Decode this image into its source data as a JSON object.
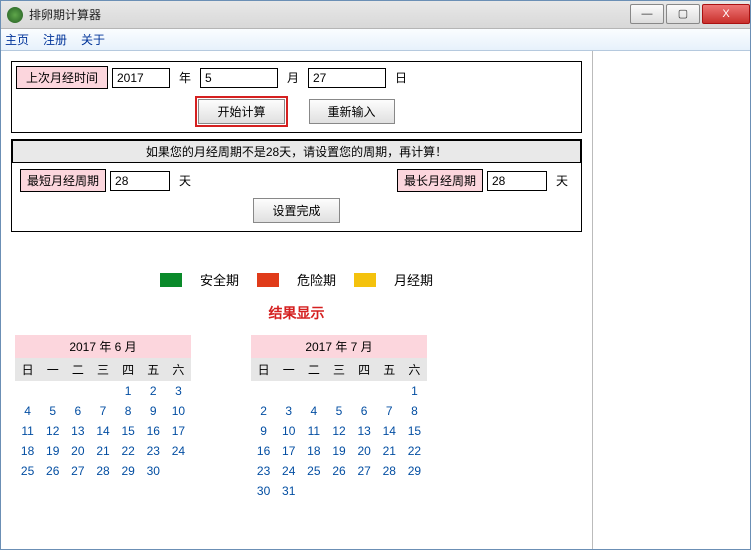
{
  "window": {
    "title": "排卵期计算器"
  },
  "menu": {
    "items": [
      "主页",
      "注册",
      "关于"
    ]
  },
  "dateSection": {
    "label": "上次月经时间",
    "year": "2017",
    "yearUnit": "年",
    "month": "5",
    "monthUnit": "月",
    "day": "27",
    "dayUnit": "日"
  },
  "buttons": {
    "calc": "开始计算",
    "reset": "重新输入",
    "setDone": "设置完成"
  },
  "cycle": {
    "hint": "如果您的月经周期不是28天，请设置您的周期，再计算！",
    "minLabel": "最短月经周期",
    "min": "28",
    "unit": "天",
    "maxLabel": "最长月经周期",
    "max": "28"
  },
  "legend": {
    "safeColor": "#0a8a2a",
    "safe": "安全期",
    "dangerColor": "#e03b1a",
    "danger": "危险期",
    "mensColor": "#f4c20d",
    "mens": "月经期"
  },
  "result": {
    "title": "结果显示"
  },
  "weekHeads": [
    "日",
    "一",
    "二",
    "三",
    "四",
    "五",
    "六"
  ],
  "cal1": {
    "title": "2017 年 6 月",
    "startBlank": 4,
    "days": 30
  },
  "cal2": {
    "title": "2017 年 7 月",
    "startBlank": 6,
    "days": 31
  },
  "winBtns": {
    "min": "—",
    "max": "▢",
    "close": "X"
  }
}
